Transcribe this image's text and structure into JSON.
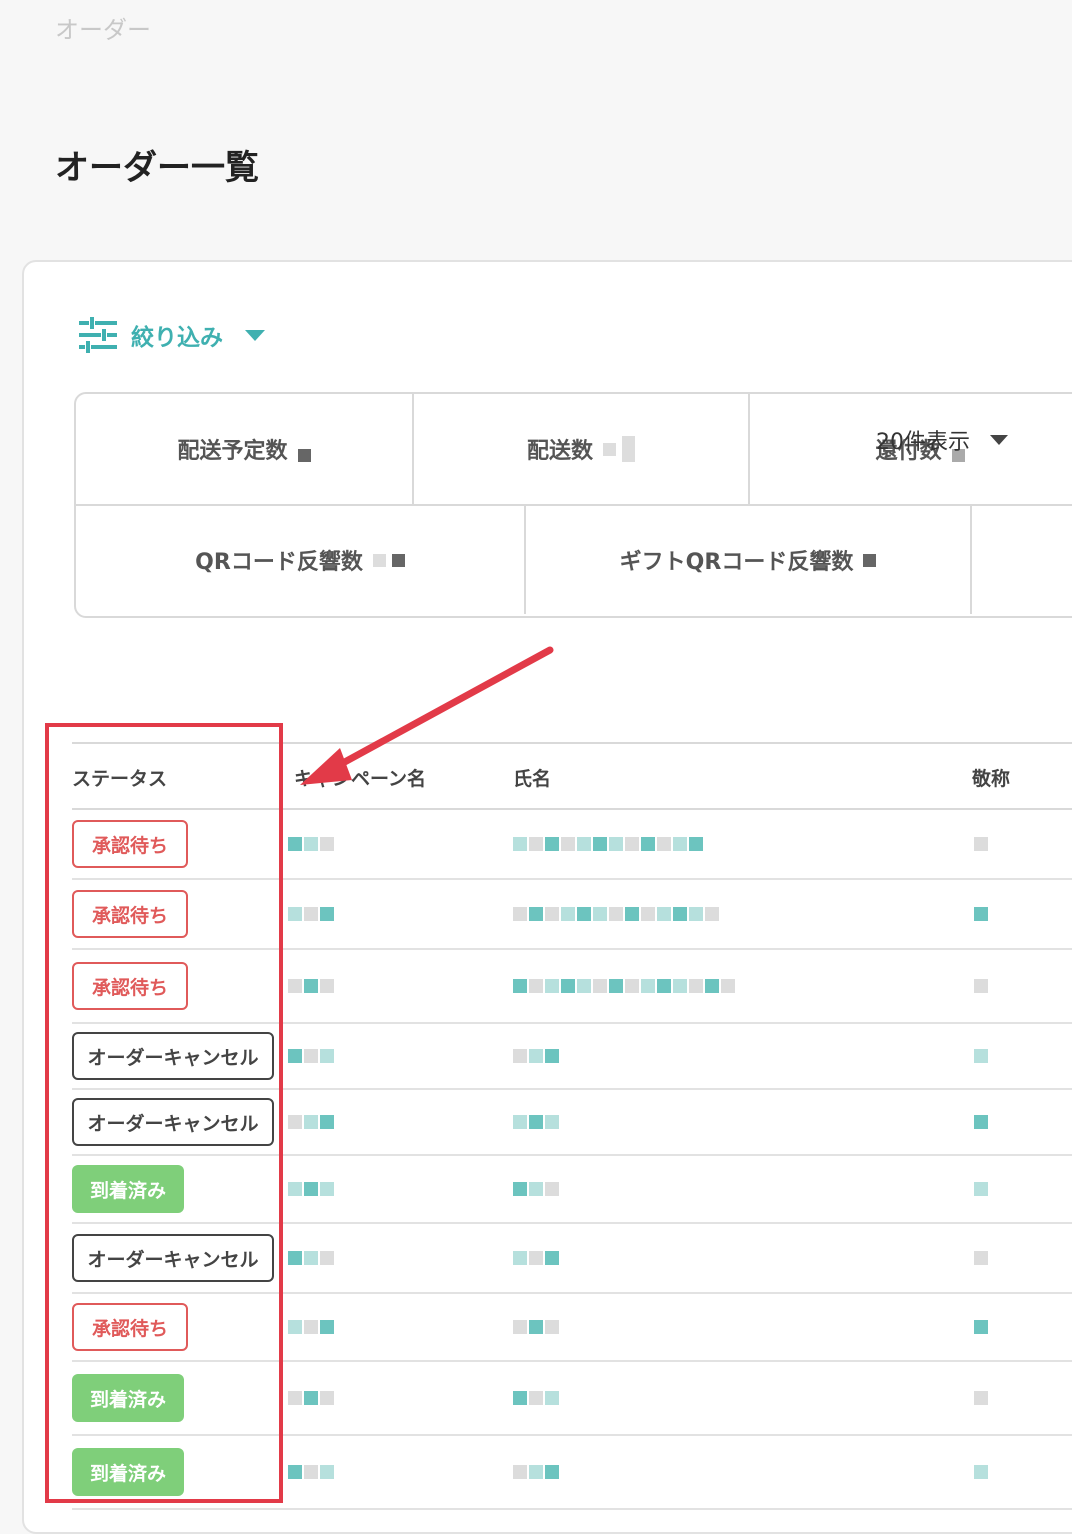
{
  "breadcrumb": "オーダー",
  "page_title": "オーダー一覧",
  "filter": {
    "label": "絞り込み",
    "icon": "sliders-icon"
  },
  "stats": {
    "row1": [
      {
        "label": "配送予定数"
      },
      {
        "label": "配送数"
      },
      {
        "label": "還付数"
      }
    ],
    "row2": [
      {
        "label": "QRコード反響数"
      },
      {
        "label": "ギフトQRコード反響数"
      }
    ]
  },
  "per_page": "20件表示",
  "table": {
    "headers": {
      "status": "ステータス",
      "campaign": "キャンペーン名",
      "name": "氏名",
      "honorific": "敬称"
    },
    "rows": [
      {
        "status": "承認待ち",
        "kind": "pending"
      },
      {
        "status": "承認待ち",
        "kind": "pending"
      },
      {
        "status": "承認待ち",
        "kind": "pending"
      },
      {
        "status": "オーダーキャンセル",
        "kind": "cancel"
      },
      {
        "status": "オーダーキャンセル",
        "kind": "cancel"
      },
      {
        "status": "到着済み",
        "kind": "arrived"
      },
      {
        "status": "オーダーキャンセル",
        "kind": "cancel"
      },
      {
        "status": "承認待ち",
        "kind": "pending"
      },
      {
        "status": "到着済み",
        "kind": "arrived"
      },
      {
        "status": "到着済み",
        "kind": "arrived"
      }
    ]
  },
  "colors": {
    "accent": "#3fb0b0",
    "pending": "#e05a5a",
    "arrived": "#7fcf7a",
    "annotation": "#e23a48"
  }
}
